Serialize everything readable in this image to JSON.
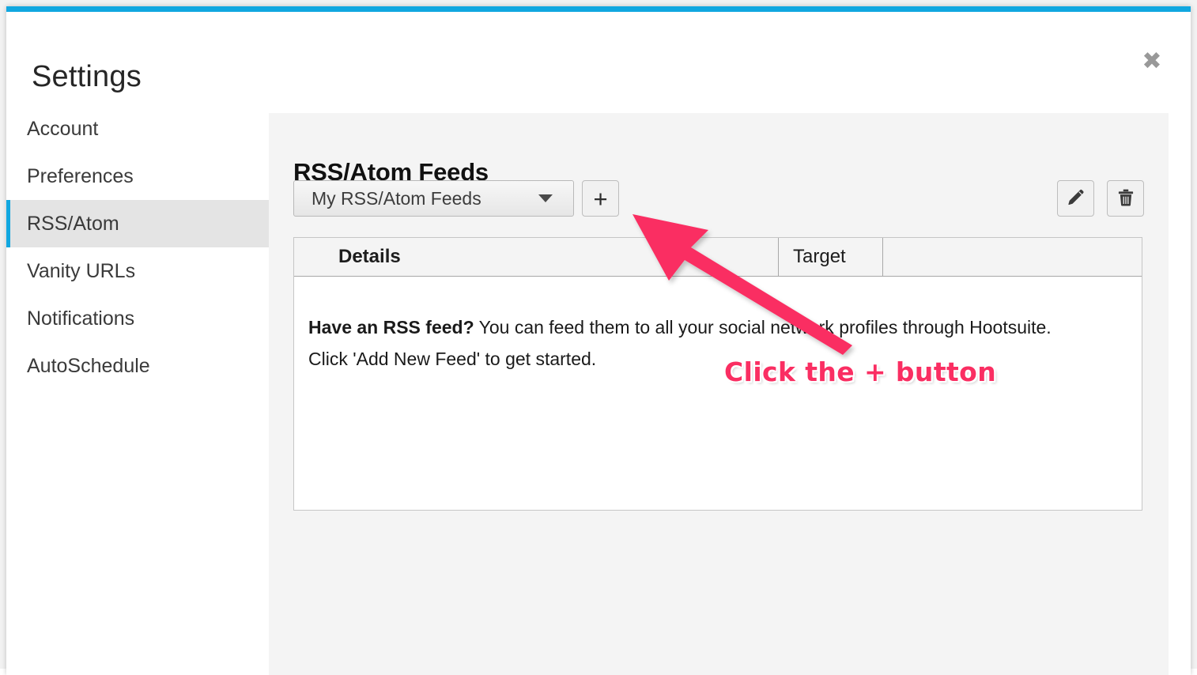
{
  "modal": {
    "title": "Settings",
    "close_icon": "close-icon"
  },
  "sidebar": {
    "items": [
      {
        "label": "Account",
        "active": false
      },
      {
        "label": "Preferences",
        "active": false
      },
      {
        "label": "RSS/Atom",
        "active": true
      },
      {
        "label": "Vanity URLs",
        "active": false
      },
      {
        "label": "Notifications",
        "active": false
      },
      {
        "label": "AutoSchedule",
        "active": false
      }
    ]
  },
  "content": {
    "section_title": "RSS/Atom Feeds",
    "toolbar": {
      "feed_select_value": "My RSS/Atom Feeds",
      "add_label": "+",
      "edit_icon": "pencil-icon",
      "delete_icon": "trash-icon"
    },
    "table": {
      "columns": [
        "Details",
        "Target",
        ""
      ],
      "empty_state": {
        "lead": "Have an RSS feed?",
        "body": " You can feed them to all your social network profiles through Hootsuite.",
        "cta": "Click 'Add New Feed' to get started."
      }
    }
  },
  "annotation": {
    "text": "Click the + button",
    "arrow": "arrow-up-left",
    "color": "#fa2e62"
  },
  "colors": {
    "accent_blue": "#11a7e0",
    "annotation_pink": "#fa2e62",
    "panel_gray": "#f4f4f4",
    "sidebar_active": "#e4e4e4"
  }
}
